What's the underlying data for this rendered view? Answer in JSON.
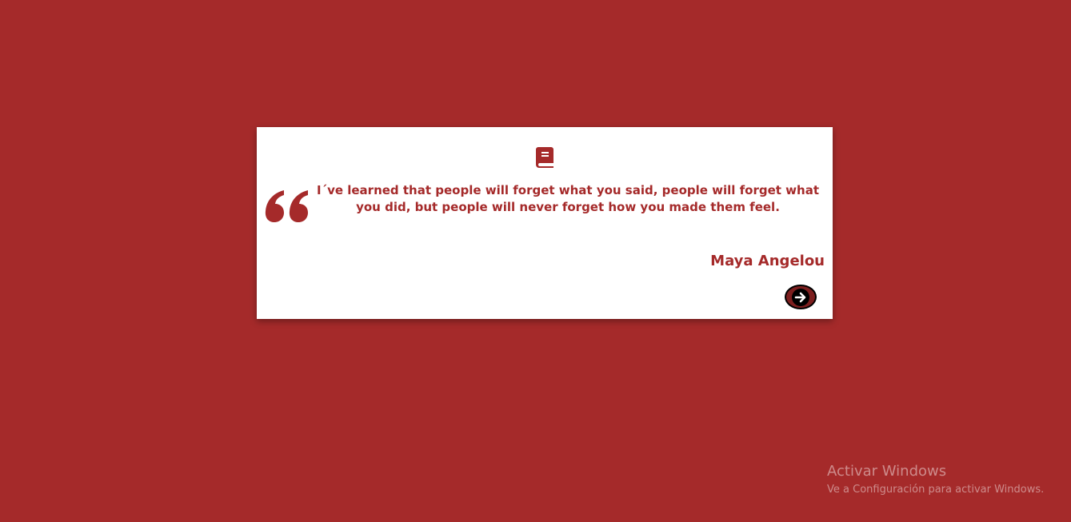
{
  "card": {
    "icon": "book-icon",
    "quote_icon": "quote-left-icon",
    "quote": "I´ve learned that people will forget what you said, people will forget what you did, but people will never forget how you made them feel.",
    "author": "Maya Angelou",
    "next_icon": "arrow-circle-right-icon"
  },
  "watermark": {
    "title": "Activar Windows",
    "subtitle": "Ve a Configuración para activar Windows."
  },
  "colors": {
    "background": "#a52a2a",
    "card": "#ffffff",
    "accent": "#a52a2a",
    "button": "#7d1f1f"
  }
}
